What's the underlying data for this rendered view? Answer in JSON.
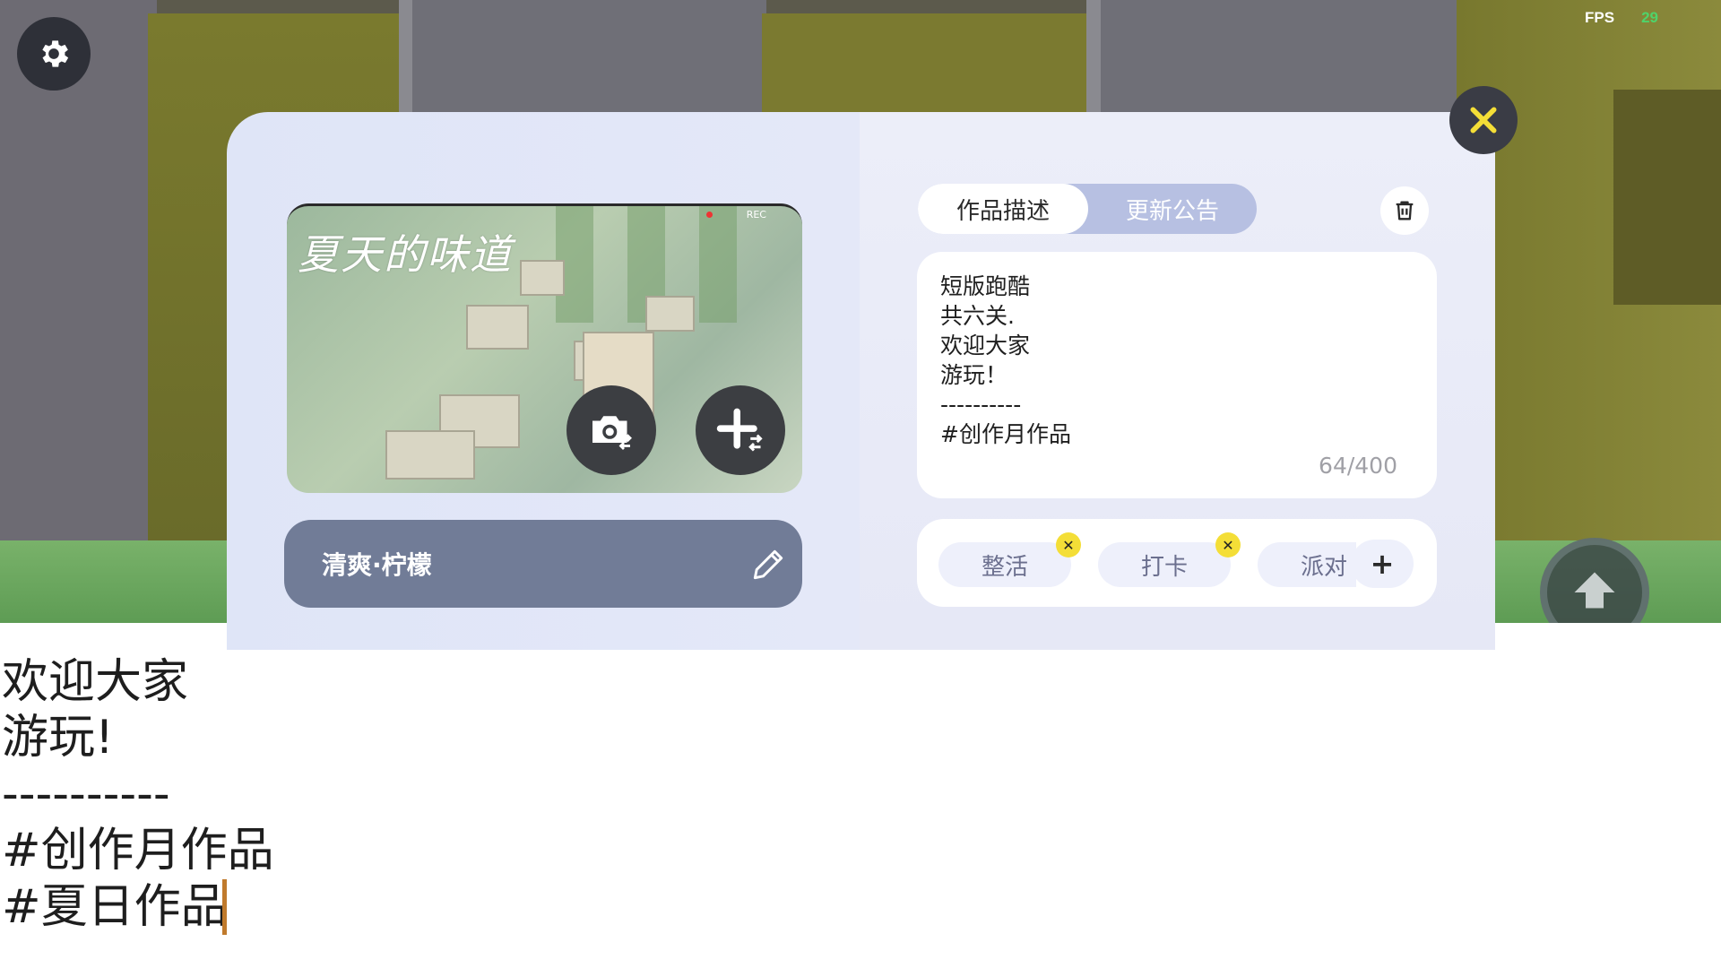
{
  "hud": {
    "fps_label": "FPS",
    "fps_value": "29"
  },
  "preview": {
    "title": "夏天的味道",
    "rec_label": "REC"
  },
  "map_name": "清爽·柠檬",
  "tabs": {
    "description": "作品描述",
    "notice": "更新公告",
    "active": "description"
  },
  "description": {
    "lines": [
      "短版跑酷",
      "共六关.",
      "欢迎大家",
      "游玩！",
      "----------",
      "#创作月作品"
    ],
    "counter": "64/400"
  },
  "tags": [
    {
      "label": "整活"
    },
    {
      "label": "打卡"
    },
    {
      "label": "派对"
    }
  ],
  "add_tag_label": "+",
  "edit_input": {
    "lines": [
      "欢迎大家",
      "游玩!",
      "----------",
      "#创作月作品",
      "#夏日作品"
    ]
  },
  "colors": {
    "accent_tab": "#b7c0e2",
    "name_bar": "#717c97",
    "tag_remove": "#f4de37",
    "fps_value": "#4fd36a",
    "caret": "#c07a2c"
  },
  "icons": {
    "settings": "gear-icon",
    "close": "close-icon",
    "camera": "camera-switch-icon",
    "add_image": "add-image-icon",
    "edit": "pencil-icon",
    "trash": "trash-icon",
    "jump": "arrow-up-icon"
  }
}
